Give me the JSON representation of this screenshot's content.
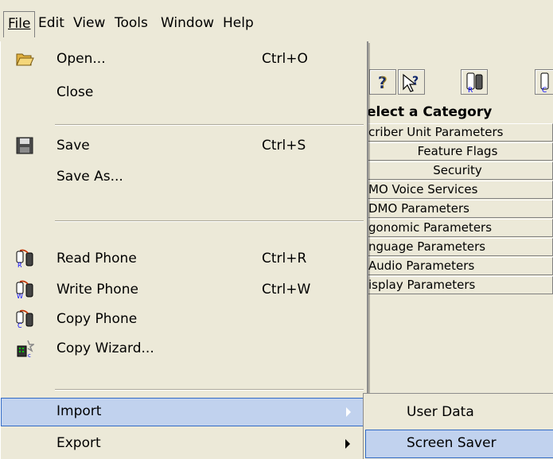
{
  "menubar": {
    "file": "File",
    "edit": "Edit",
    "view": "View",
    "tools": "Tools",
    "window": "Window",
    "help": "Help"
  },
  "category": {
    "header": "elect a Category",
    "rows": [
      "criber Unit Parameters",
      "Feature Flags",
      "Security",
      "MO Voice Services",
      "DMO Parameters",
      "gonomic Parameters",
      "nguage Parameters",
      "Audio Parameters",
      "isplay Parameters"
    ]
  },
  "filemenu": {
    "open": {
      "label": "Open...",
      "shortcut": "Ctrl+O",
      "icon": "open-folder-icon"
    },
    "close": {
      "label": "Close"
    },
    "save": {
      "label": "Save",
      "shortcut": "Ctrl+S",
      "icon": "floppy-disk-icon"
    },
    "save_as": {
      "label": "Save As..."
    },
    "read_phone": {
      "label": "Read Phone",
      "shortcut": "Ctrl+R",
      "icon": "read-phone-icon"
    },
    "write_phone": {
      "label": "Write Phone",
      "shortcut": "Ctrl+W",
      "icon": "write-phone-icon"
    },
    "copy_phone": {
      "label": "Copy Phone",
      "icon": "copy-phone-icon"
    },
    "copy_wizard": {
      "label": "Copy Wizard...",
      "icon": "wizard-icon"
    },
    "import": {
      "label": "Import"
    },
    "export": {
      "label": "Export"
    }
  },
  "submenu": {
    "user_data": "User Data",
    "screen_saver": "Screen Saver"
  },
  "colors": {
    "menu_bg": "#ece9d8",
    "highlight_bg": "#c1d2ee",
    "highlight_border": "#316ac5"
  }
}
